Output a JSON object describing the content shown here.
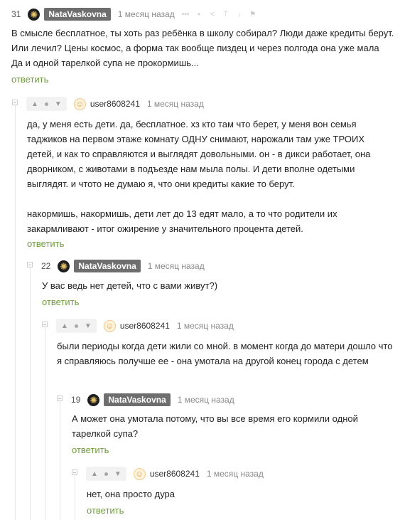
{
  "reply_label": "ответить",
  "comments": [
    {
      "rating": "31",
      "author": "NataVaskovna",
      "time": "1 месяц назад",
      "paragraphs": [
        "В смысле бесплатное, ты хоть раз ребёнка в школу собирал? Люди даже кредиты берут.",
        "Или лечил? Цены космос, а форма так вообще пиздец и через полгода она уже мала",
        "Да и одной тарелкой супа не прокормишь..."
      ]
    },
    {
      "author": "user8608241",
      "time": "1 месяц назад",
      "paragraphs": [
        "да, у меня есть дети. да, бесплатное. хз кто там что берет, у меня вон семья таджиков на первом этаже комнату ОДНУ снимают, нарожали там уже ТРОИХ детей, и как то справляются и выглядят довольными. он - в дикси работает, она дворником, с животами в подъезде нам мыла полы. И дети вполне одетыми выглядят. и чтото не думаю я, что они кредиты какие то берут.",
        "накормишь, накормишь, дети лет до 13 едят мало, а то что родители их закармливают - итог ожирение у значительного процента детей."
      ]
    },
    {
      "rating": "22",
      "author": "NataVaskovna",
      "time": "1 месяц назад",
      "paragraphs": [
        "У вас ведь нет детей, что с вами живут?)"
      ]
    },
    {
      "author": "user8608241",
      "time": "1 месяц назад",
      "paragraphs": [
        "были периоды когда дети жили со мной. в момент когда до матери дошло что я справляюсь получше ее - она умотала на другой конец города с детем"
      ]
    },
    {
      "rating": "19",
      "author": "NataVaskovna",
      "time": "1 месяц назад",
      "paragraphs": [
        "А может она умотала потому, что вы все время его кормили одной тарелкой супа?"
      ]
    },
    {
      "author": "user8608241",
      "time": "1 месяц назад",
      "paragraphs": [
        "нет, она просто дура"
      ]
    }
  ]
}
